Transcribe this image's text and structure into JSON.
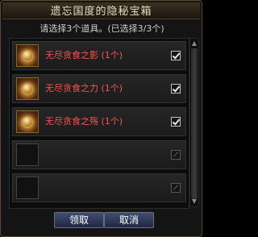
{
  "window": {
    "title": "遗忘国度的隐秘宝箱",
    "subtitle": "请选择3个道具。(已选择3/3个)"
  },
  "items": [
    {
      "label": "无尽贪食之影 (1个)",
      "checked": true,
      "icon": "ring-icon"
    },
    {
      "label": "无尽贪食之力 (1个)",
      "checked": true,
      "icon": "ring-icon"
    },
    {
      "label": "无尽贪食之殇 (1个)",
      "checked": true,
      "icon": "ring-icon"
    },
    {
      "label": "",
      "checked": false,
      "icon": "empty-slot"
    },
    {
      "label": "",
      "checked": false,
      "icon": "empty-slot"
    }
  ],
  "scroll": {
    "up_icon": "▲",
    "down_icon": "▼"
  },
  "buttons": {
    "confirm_label": "领取",
    "cancel_label": "取消"
  },
  "colors": {
    "item_text": "#ff5050",
    "button_bg": "#2f3a58",
    "title_text": "#e9dcc0"
  }
}
